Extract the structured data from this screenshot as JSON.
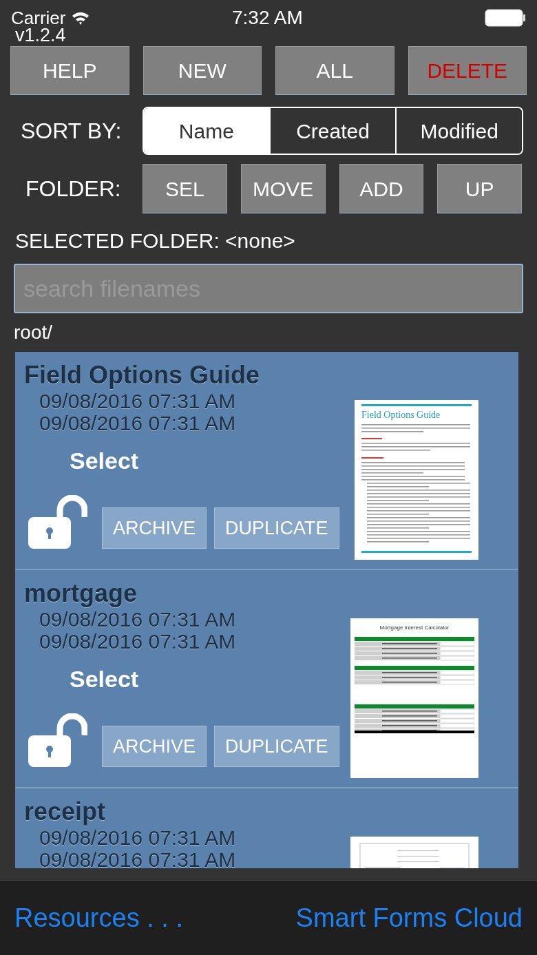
{
  "status_bar": {
    "carrier": "Carrier",
    "time": "7:32 AM"
  },
  "version": "v1.2.4",
  "top_buttons": [
    {
      "label": "HELP",
      "kind": "normal"
    },
    {
      "label": "NEW",
      "kind": "normal"
    },
    {
      "label": "ALL",
      "kind": "normal"
    },
    {
      "label": "DELETE",
      "kind": "danger"
    }
  ],
  "sort": {
    "label": "SORT BY:",
    "options": [
      {
        "label": "Name",
        "selected": true
      },
      {
        "label": "Created",
        "selected": false
      },
      {
        "label": "Modified",
        "selected": false
      }
    ]
  },
  "folder": {
    "label": "FOLDER:",
    "buttons": [
      "SEL",
      "MOVE",
      "ADD",
      "UP"
    ]
  },
  "selected_folder": "SELECTED FOLDER: <none>",
  "search": {
    "placeholder": "search filenames"
  },
  "path": "root/",
  "files": [
    {
      "name": "Field Options Guide",
      "created": "09/08/2016 07:31 AM",
      "modified": "09/08/2016 07:31 AM",
      "select_label": "Select",
      "locked": false,
      "actions": [
        "ARCHIVE",
        "DUPLICATE"
      ],
      "thumbnail": {
        "kind": "guide",
        "title": "Field Options Guide"
      }
    },
    {
      "name": "mortgage",
      "created": "09/08/2016 07:31 AM",
      "modified": "09/08/2016 07:31 AM",
      "select_label": "Select",
      "locked": false,
      "actions": [
        "ARCHIVE",
        "DUPLICATE"
      ],
      "thumbnail": {
        "kind": "table",
        "title": "Mortgage Interest Calculator"
      }
    },
    {
      "name": "receipt",
      "created": "09/08/2016 07:31 AM",
      "modified": "09/08/2016 07:31 AM",
      "thumbnail": {
        "kind": "receipt"
      }
    }
  ],
  "footer": {
    "links": [
      "Resources . . .",
      "Smart Forms Cloud"
    ]
  }
}
